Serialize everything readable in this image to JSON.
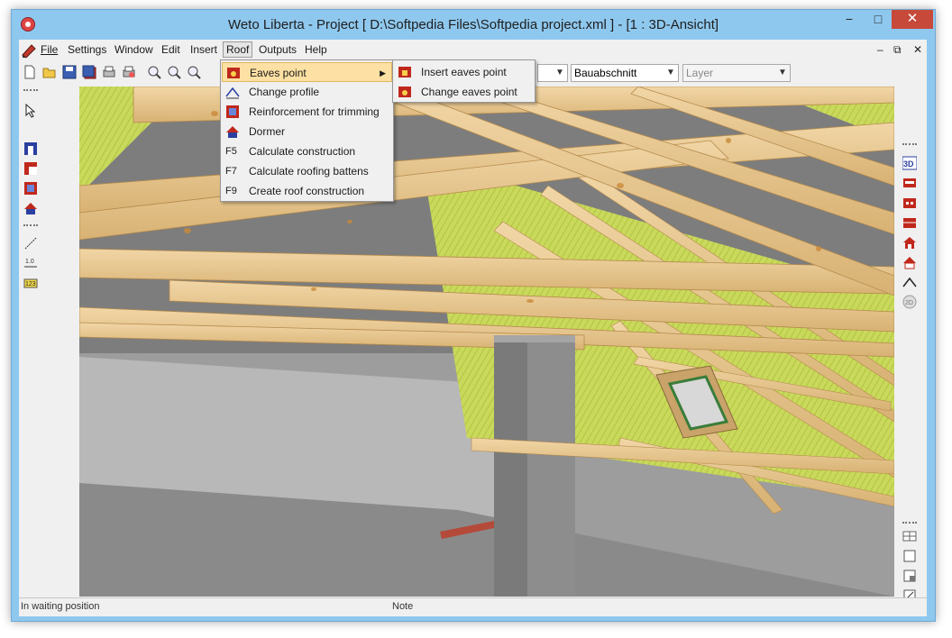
{
  "window": {
    "title": "Weto Liberta - Project [ D:\\Softpedia Files\\Softpedia project.xml ]  - [1 : 3D-Ansicht]",
    "minimize": "−",
    "maximize": "□",
    "close": "✕"
  },
  "menubar": {
    "items": [
      {
        "label": "File"
      },
      {
        "label": "Settings"
      },
      {
        "label": "Window"
      },
      {
        "label": "Edit"
      },
      {
        "label": "Insert"
      },
      {
        "label": "Roof"
      },
      {
        "label": "Outputs"
      },
      {
        "label": "Help"
      }
    ],
    "mdi_min": "–",
    "mdi_restore": "⧉",
    "mdi_close": "✕"
  },
  "toolbar": {
    "combo_section": "Bauabschnitt",
    "combo_layer": "Layer"
  },
  "roof_menu": {
    "items": [
      {
        "key": "",
        "label": "Eaves point",
        "icon": "eaves-point-icon",
        "has_submenu": true
      },
      {
        "key": "",
        "label": "Change profile",
        "icon": "change-profile-icon"
      },
      {
        "key": "",
        "label": "Reinforcement for trimming",
        "icon": "reinforcement-icon"
      },
      {
        "key": "",
        "label": "Dormer",
        "icon": "dormer-icon"
      },
      {
        "key": "F5",
        "label": "Calculate construction"
      },
      {
        "key": "F7",
        "label": "Calculate roofing battens"
      },
      {
        "key": "F9",
        "label": "Create roof construction"
      }
    ]
  },
  "eaves_submenu": {
    "items": [
      {
        "label": "Insert eaves point",
        "icon": "insert-eaves-icon"
      },
      {
        "label": "Change eaves point",
        "icon": "change-eaves-icon"
      }
    ]
  },
  "statusbar": {
    "left": "In waiting position",
    "note": "Note"
  },
  "colors": {
    "title_bg": "#8fc8ee",
    "menu_highlight": "#fde0a3",
    "close_button": "#c7493a",
    "wood": "#e8c58e",
    "insulation": "#c6d85a"
  }
}
